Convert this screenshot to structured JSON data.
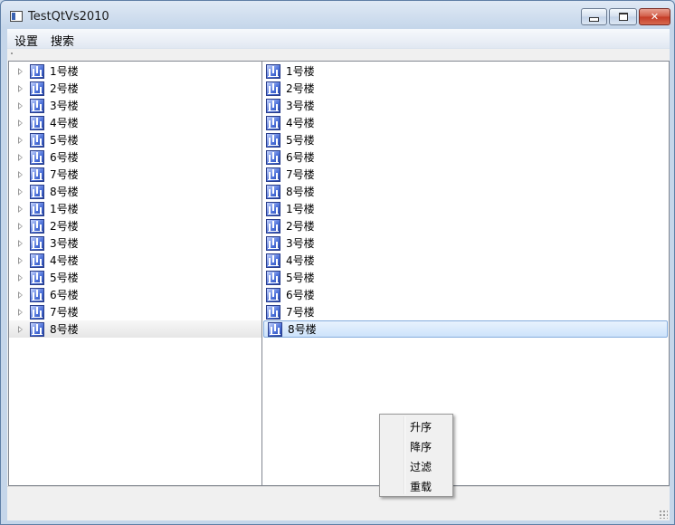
{
  "window": {
    "title": "TestQtVs2010"
  },
  "menubar": {
    "items": [
      "设置",
      "搜索"
    ]
  },
  "left_tree": {
    "items": [
      "1号楼",
      "2号楼",
      "3号楼",
      "4号楼",
      "5号楼",
      "6号楼",
      "7号楼",
      "8号楼",
      "1号楼",
      "2号楼",
      "3号楼",
      "4号楼",
      "5号楼",
      "6号楼",
      "7号楼",
      "8号楼"
    ],
    "selected_index": 15
  },
  "right_list": {
    "items": [
      "1号楼",
      "2号楼",
      "3号楼",
      "4号楼",
      "5号楼",
      "6号楼",
      "7号楼",
      "8号楼",
      "1号楼",
      "2号楼",
      "3号楼",
      "4号楼",
      "5号楼",
      "6号楼",
      "7号楼",
      "8号楼"
    ],
    "selected_index": 15
  },
  "context_menu": {
    "items": [
      "升序",
      "降序",
      "过滤",
      "重载"
    ]
  },
  "icons": {
    "building": "chart-icon",
    "expand": "triangle-right-icon"
  }
}
